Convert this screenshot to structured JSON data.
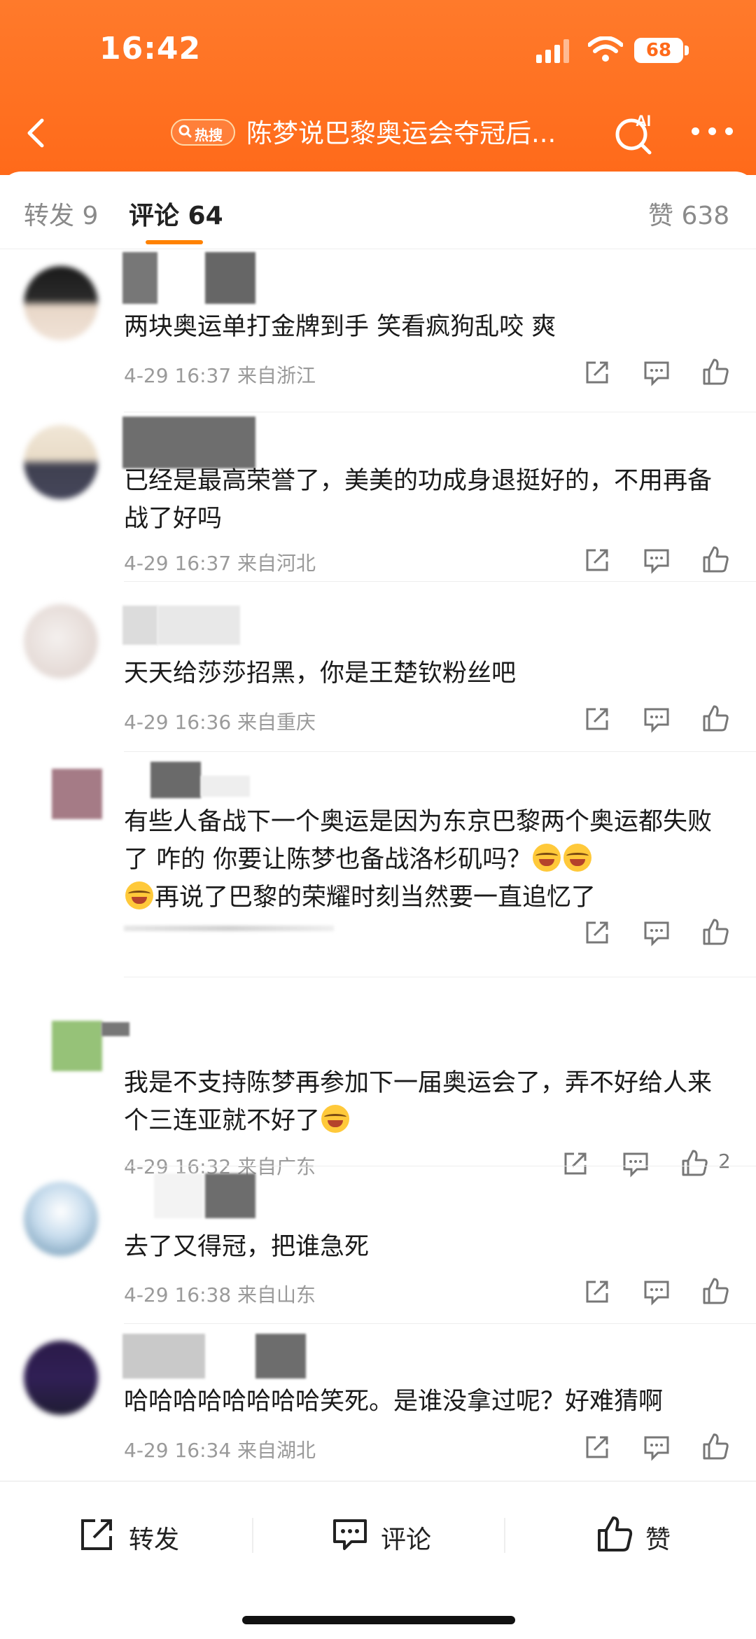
{
  "status_bar": {
    "time": "16:42",
    "battery": "68"
  },
  "nav": {
    "hot_badge": "热搜",
    "title": "陈梦说巴黎奥运会夺冠后..."
  },
  "tabs": {
    "forward": "转发 9",
    "comments": "评论 64",
    "likes": "赞 638"
  },
  "comments": [
    {
      "text": "两块奥运单打金牌到手 笑看疯狗乱咬 爽",
      "meta": "4-29 16:37 来自浙江"
    },
    {
      "text": "已经是最高荣誉了，美美的功成身退挺好的，不用再备战了好吗",
      "meta": "4-29 16:37 来自河北"
    },
    {
      "text": "天天给莎莎招黑，你是王楚钦粉丝吧",
      "meta": "4-29 16:36 来自重庆"
    },
    {
      "text_a": "有些人备战下一个奥运是因为东京巴黎两个奥运都失败了 咋的 你要让陈梦也备战洛杉矶吗？",
      "text_b": "再说了巴黎的荣耀时刻当然要一直追忆了",
      "meta": ""
    },
    {
      "text": "我是不支持陈梦再参加下一届奥运会了，弄不好给人来个三连亚就不好了",
      "meta": "4-29 16:32 来自广东",
      "likes": "2"
    },
    {
      "text": "去了又得冠，把谁急死",
      "meta": "4-29 16:38 来自山东"
    },
    {
      "text": "哈哈哈哈哈哈哈哈笑死。是谁没拿过呢？好难猜啊",
      "meta": "4-29 16:34 来自湖北"
    }
  ],
  "bottom_bar": {
    "forward": "转发",
    "comment": "评论",
    "like": "赞"
  },
  "colors": {
    "brand": "#ff6a1a",
    "accent": "#ff8200"
  }
}
